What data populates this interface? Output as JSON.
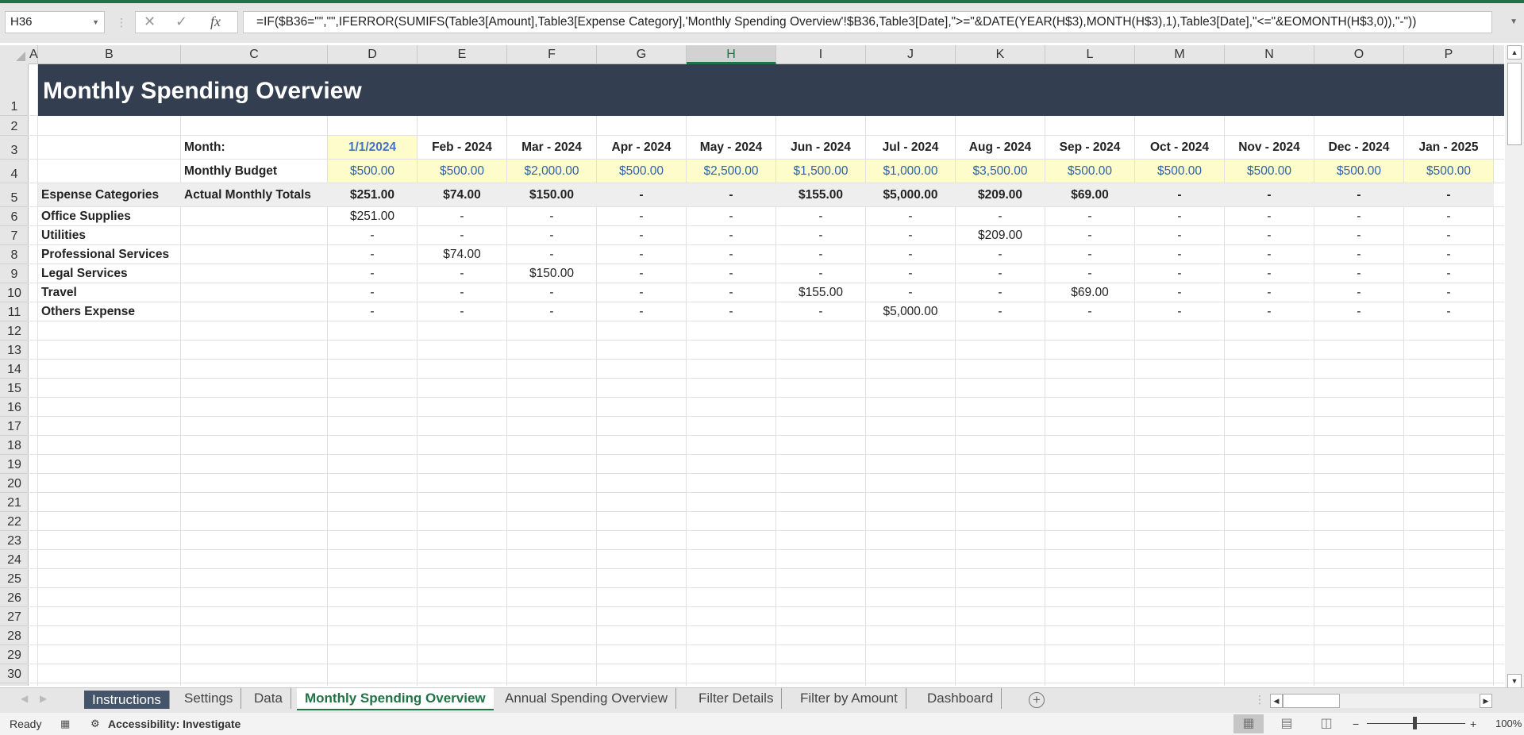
{
  "formula_bar": {
    "name_box": "H36",
    "cancel_icon": "✕",
    "enter_icon": "✓",
    "fx_label": "fx",
    "formula": "=IF($B36=\"\",\"\",IFERROR(SUMIFS(Table3[Amount],Table3[Expense Category],'Monthly Spending Overview'!$B36,Table3[Date],\">=\"&DATE(YEAR(H$3),MONTH(H$3),1),Table3[Date],\"<=\"&EOMONTH(H$3,0)),\"-\"))"
  },
  "columns": [
    "A",
    "B",
    "C",
    "D",
    "E",
    "F",
    "G",
    "H",
    "I",
    "J",
    "K",
    "L",
    "M",
    "N",
    "O",
    "P"
  ],
  "selected_column": "H",
  "rows": [
    "1",
    "2",
    "3",
    "4",
    "5",
    "6",
    "7",
    "8",
    "9",
    "10",
    "11",
    "12",
    "13",
    "14",
    "15",
    "16",
    "17",
    "18",
    "19",
    "20",
    "21",
    "22",
    "23",
    "24",
    "25",
    "26",
    "27",
    "28",
    "29",
    "30"
  ],
  "sheet": {
    "title": "Monthly Spending Overview",
    "month_label": "Month:",
    "budget_label": "Monthly Budget",
    "categories_header": "Espense Categories",
    "totals_header": "Actual Monthly Totals",
    "months": [
      "1/1/2024",
      "Feb - 2024",
      "Mar - 2024",
      "Apr - 2024",
      "May - 2024",
      "Jun - 2024",
      "Jul - 2024",
      "Aug - 2024",
      "Sep - 2024",
      "Oct - 2024",
      "Nov - 2024",
      "Dec - 2024",
      "Jan - 2025"
    ],
    "budgets": [
      "$500.00",
      "$500.00",
      "$2,000.00",
      "$500.00",
      "$2,500.00",
      "$1,500.00",
      "$1,000.00",
      "$3,500.00",
      "$500.00",
      "$500.00",
      "$500.00",
      "$500.00",
      "$500.00"
    ],
    "totals": [
      "$251.00",
      "$74.00",
      "$150.00",
      "-",
      "-",
      "$155.00",
      "$5,000.00",
      "$209.00",
      "$69.00",
      "-",
      "-",
      "-",
      "-"
    ],
    "categories": [
      {
        "name": "Office Supplies",
        "values": [
          "$251.00",
          "-",
          "-",
          "-",
          "-",
          "-",
          "-",
          "-",
          "-",
          "-",
          "-",
          "-",
          "-"
        ]
      },
      {
        "name": "Utilities",
        "values": [
          "-",
          "-",
          "-",
          "-",
          "-",
          "-",
          "-",
          "$209.00",
          "-",
          "-",
          "-",
          "-",
          "-"
        ]
      },
      {
        "name": "Professional Services",
        "values": [
          "-",
          "$74.00",
          "-",
          "-",
          "-",
          "-",
          "-",
          "-",
          "-",
          "-",
          "-",
          "-",
          "-"
        ]
      },
      {
        "name": "Legal Services",
        "values": [
          "-",
          "-",
          "$150.00",
          "-",
          "-",
          "-",
          "-",
          "-",
          "-",
          "-",
          "-",
          "-",
          "-"
        ]
      },
      {
        "name": "Travel",
        "values": [
          "-",
          "-",
          "-",
          "-",
          "-",
          "$155.00",
          "-",
          "-",
          "$69.00",
          "-",
          "-",
          "-",
          "-"
        ]
      },
      {
        "name": "Others Expense",
        "values": [
          "-",
          "-",
          "-",
          "-",
          "-",
          "-",
          "$5,000.00",
          "-",
          "-",
          "-",
          "-",
          "-",
          "-"
        ]
      }
    ]
  },
  "sheet_tabs": [
    {
      "label": "Instructions",
      "style": "dark"
    },
    {
      "label": "Settings",
      "style": "normal"
    },
    {
      "label": "Data",
      "style": "normal"
    },
    {
      "label": "Monthly Spending Overview",
      "style": "active"
    },
    {
      "label": "Annual Spending Overview",
      "style": "normal"
    },
    {
      "label": "Filter Details",
      "style": "normal"
    },
    {
      "label": "Filter by Amount",
      "style": "normal"
    },
    {
      "label": "Dashboard",
      "style": "normal"
    }
  ],
  "add_sheet_icon": "+",
  "status_bar": {
    "ready": "Ready",
    "accessibility": "Accessibility: Investigate",
    "zoom_minus": "−",
    "zoom_plus": "+",
    "zoom_level": "100%"
  },
  "colors": {
    "title_bg": "#333f50",
    "accent": "#217346",
    "budget_bg": "#fffccc",
    "totals_bg": "#eeeeee",
    "current_month": "#4472c4"
  }
}
